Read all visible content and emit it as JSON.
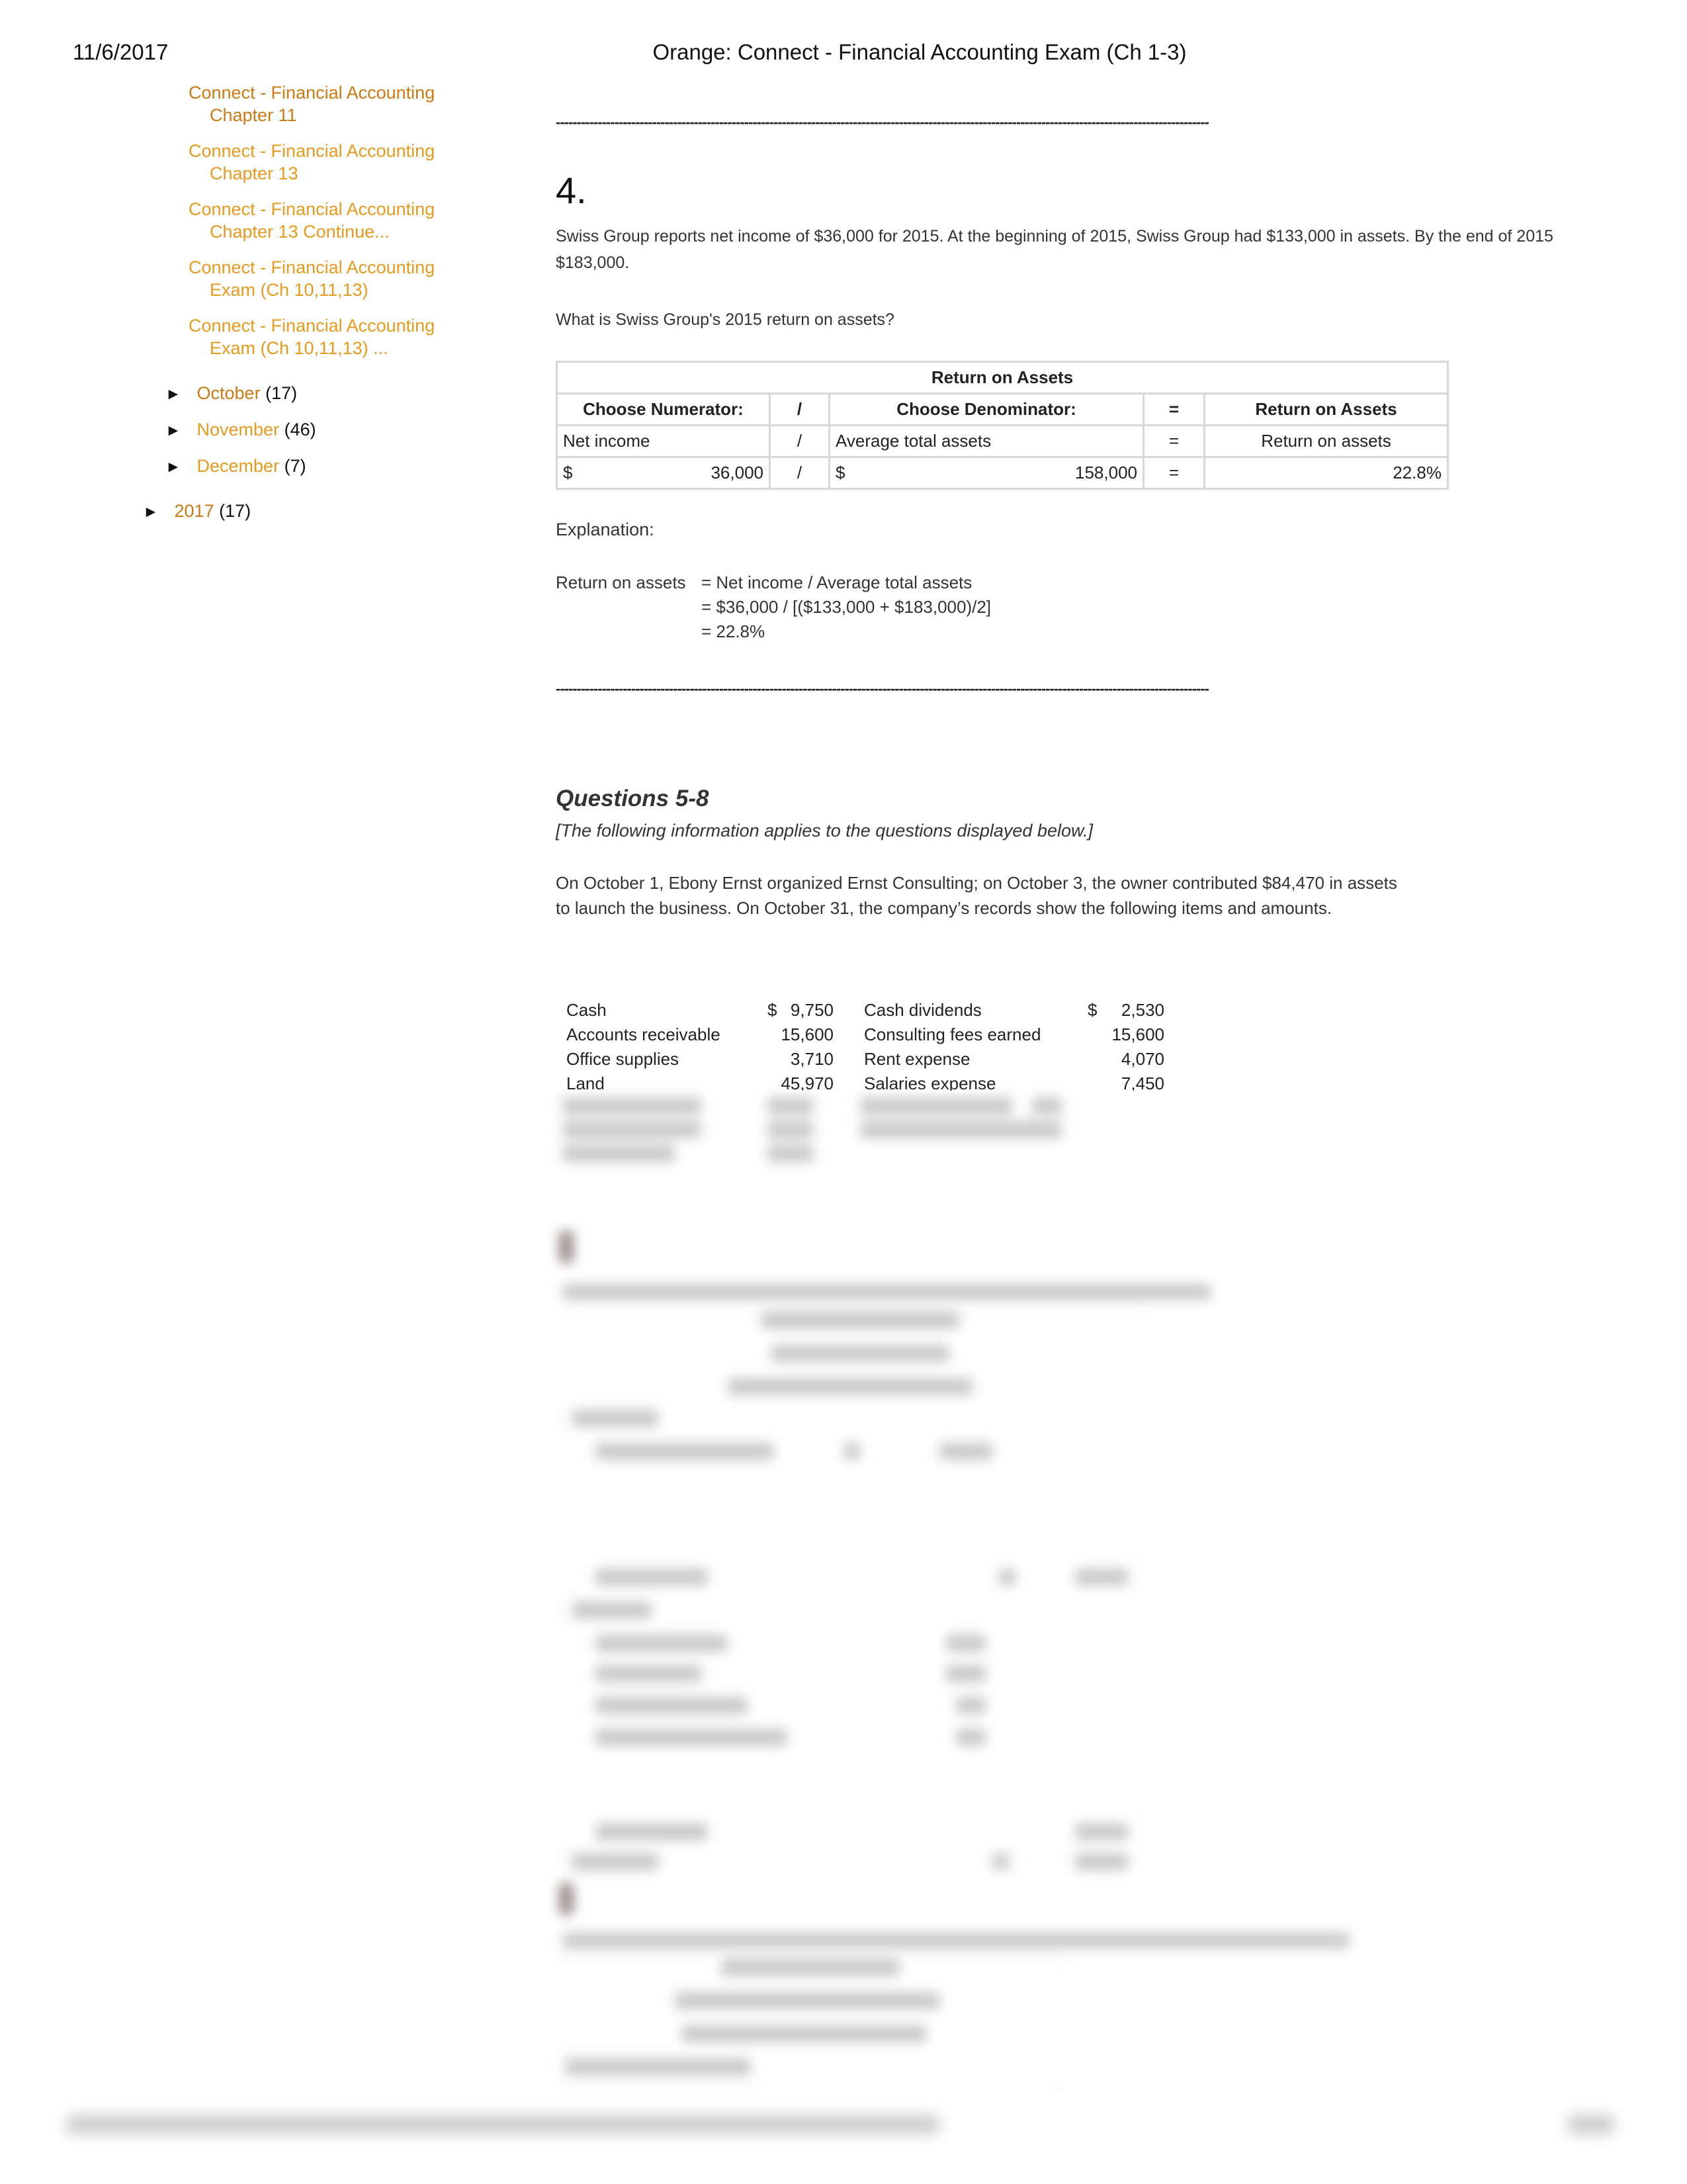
{
  "header": {
    "date": "11/6/2017",
    "title": "Orange: Connect - Financial Accounting Exam (Ch 1-3)"
  },
  "sidebar": {
    "post_links": [
      {
        "line1": "Connect - Financial Accounting",
        "line2": "Chapter 11",
        "visited": true
      },
      {
        "line1": "Connect - Financial Accounting",
        "line2": "Chapter 13",
        "visited": false
      },
      {
        "line1": "Connect - Financial Accounting",
        "line2": "Chapter 13 Continue...",
        "visited": false
      },
      {
        "line1": "Connect - Financial Accounting",
        "line2": "Exam (Ch 10,11,13)",
        "visited": false
      },
      {
        "line1": "Connect - Financial Accounting",
        "line2": "Exam (Ch 10,11,13) ...",
        "visited": false
      }
    ],
    "archive_months": [
      {
        "toggle": "►",
        "label": "October",
        "count": "(17)"
      },
      {
        "toggle": "►",
        "label": "November",
        "count": "(46)"
      },
      {
        "toggle": "►",
        "label": "December",
        "count": "(7)"
      }
    ],
    "archive_years": [
      {
        "toggle": "►",
        "label": "2017",
        "count": "(17)"
      }
    ]
  },
  "main": {
    "separator": "------------------------------------------------------------------------------------------------------------------------------------------------------------",
    "question4": {
      "number": "4.",
      "text_line1": "Swiss Group reports net income of $36,000 for 2015. At the beginning of 2015, Swiss Group had $133,000 in assets. By the end of 2015",
      "text_line2": "$183,000.",
      "prompt": "What is Swiss Group's 2015 return on assets?",
      "table": {
        "title": "Return on Assets",
        "headers": [
          "Choose Numerator:",
          "/",
          "Choose Denominator:",
          "=",
          "Return on Assets"
        ],
        "labels_row": [
          "Net income",
          "/",
          "Average total assets",
          "=",
          "Return on assets"
        ],
        "values_row": {
          "num_currency": "$",
          "num_value": "36,000",
          "op1": "/",
          "den_currency": "$",
          "den_value": "158,000",
          "op2": "=",
          "result": "22.8%"
        }
      },
      "explanation_label": "Explanation:",
      "explanation": {
        "label": "Return on assets",
        "line1": "= Net income / Average total assets",
        "line2": "= $36,000 / [($133,000 + $183,000)/2]",
        "line3": "= 22.8%"
      }
    },
    "questions_5_8": {
      "heading": "Questions 5-8",
      "subheading": "[The following information applies to the questions displayed below.]",
      "text": "On October 1, Ebony Ernst organized Ernst Consulting; on October 3, the owner contributed $84,470 in assets to launch the business. On October 31, the company’s records show the following items and amounts.",
      "items": [
        {
          "name1": "Cash",
          "cur1": "$",
          "val1": "9,750",
          "name2": "Cash dividends",
          "cur2": "$",
          "val2": "2,530"
        },
        {
          "name1": "Accounts receivable",
          "cur1": "",
          "val1": "15,600",
          "name2": "Consulting fees earned",
          "cur2": "",
          "val2": "15,600"
        },
        {
          "name1": "Office supplies",
          "cur1": "",
          "val1": "3,710",
          "name2": "Rent expense",
          "cur2": "",
          "val2": "4,070"
        },
        {
          "name1": "Land",
          "cur1": "",
          "val1": "45,970",
          "name2": "Salaries expense",
          "cur2": "",
          "val2": "7,450"
        }
      ]
    }
  }
}
